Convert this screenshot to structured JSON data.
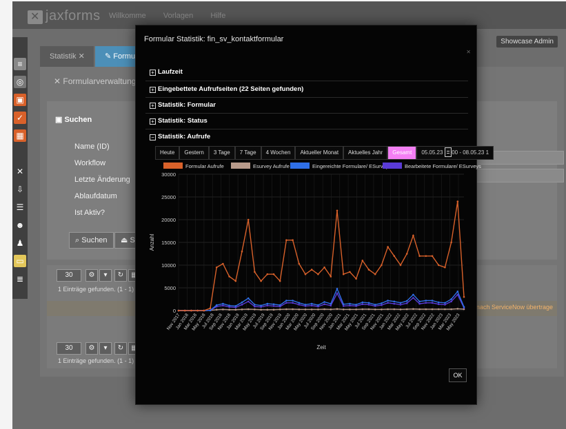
{
  "app": {
    "logo": "jaxforms",
    "nav": [
      "Willkomme",
      "Vorlagen",
      "Hilfe"
    ],
    "user": "Showcase Admin"
  },
  "tabs": [
    {
      "label": "Statistik"
    },
    {
      "label": "Formular"
    }
  ],
  "page": {
    "title": "Formularverwaltung"
  },
  "search": {
    "header": "Suchen",
    "fields": [
      "Name (ID)",
      "Workflow",
      "Letzte Änderung",
      "Ablaufdatum",
      "Ist Aktiv?"
    ],
    "search_button": "Suchen",
    "filter_button": "Suchfilt"
  },
  "grid": {
    "page_size": "30",
    "found_text": "1 Einträge gefunden. (1 - 1)",
    "row_note": "zten werden nach ServiceNow übertrage"
  },
  "modal": {
    "title": "Formular Statistik: fin_sv_kontaktformular",
    "sections": [
      {
        "label": "Laufzeit",
        "open": false
      },
      {
        "label": "Eingebettete Aufrufseiten (22 Seiten gefunden)",
        "open": false
      },
      {
        "label": "Statistik: Formular",
        "open": false
      },
      {
        "label": "Statistik: Status",
        "open": false
      },
      {
        "label": "Statistik: Aufrufe",
        "open": true
      }
    ],
    "ranges": [
      "Heute",
      "Gestern",
      "3 Tage",
      "7 Tage",
      "4 Wochen",
      "Aktueller Monat",
      "Aktuelles Jahr",
      "Gesamt"
    ],
    "active_range": "Gesamt",
    "date_range": "05.05.23 11:00 - 08.05.23 1",
    "ok_label": "OK"
  },
  "chart_data": {
    "type": "line",
    "title": "",
    "xlabel": "Zeit",
    "ylabel": "Anzahl",
    "ylim": [
      0,
      30000
    ],
    "yticks": [
      0,
      5000,
      10000,
      15000,
      20000,
      25000,
      30000
    ],
    "grid": true,
    "legend_position": "top",
    "categories": [
      "Nov 2017",
      "Jan 2018",
      "Mar 2018",
      "May 2018",
      "Jul 2018",
      "Sep 2018",
      "Nov 2018",
      "Jan 2019",
      "Mar 2019",
      "May 2019",
      "Jul 2019",
      "Sep 2019",
      "Nov 2019",
      "Jan 2020",
      "Mar 2020",
      "May 2020",
      "Jul 2020",
      "Sep 2020",
      "Nov 2020",
      "Jan 2021",
      "Mar 2021",
      "May 2021",
      "Jul 2021",
      "Sep 2021",
      "Nov 2021",
      "Jan 2022",
      "Mar 2022",
      "May 2022",
      "Jul 2022",
      "Sep 2022",
      "Nov 2022",
      "Jan 2023",
      "Mar 2023",
      "May 2023"
    ],
    "series": [
      {
        "name": "Formular Aufrufe",
        "color": "#d9612a",
        "values": [
          0,
          0,
          0,
          0,
          0,
          500,
          9500,
          10300,
          7500,
          6500,
          13000,
          20000,
          8500,
          6500,
          8000,
          8000,
          6500,
          15500,
          15500,
          10300,
          8000,
          9000,
          8000,
          9500,
          7500,
          22000,
          8000,
          8500,
          7000,
          11000,
          9000,
          8000,
          10000,
          14000,
          12000,
          10000,
          12500,
          16500,
          12000,
          12000,
          12000,
          10000,
          9500,
          15000,
          24000,
          3000
        ]
      },
      {
        "name": "Esurvey Aufrufe",
        "color": "#b89a8a",
        "values": [
          0,
          0,
          0,
          0,
          0,
          50,
          200,
          250,
          200,
          200,
          250,
          300,
          250,
          200,
          200,
          200,
          250,
          300,
          300,
          250,
          250,
          250,
          250,
          300,
          250,
          350,
          250,
          250,
          250,
          300,
          300,
          250,
          250,
          300,
          300,
          250,
          300,
          350,
          300,
          300,
          300,
          300,
          300,
          300,
          400,
          300
        ]
      },
      {
        "name": "Eingereichte Formulare/ ESurveys",
        "color": "#2f6fe8",
        "values": [
          0,
          0,
          0,
          0,
          0,
          50,
          1200,
          1500,
          1100,
          1000,
          1800,
          2700,
          1300,
          1100,
          1500,
          1400,
          1200,
          2200,
          2200,
          1700,
          1300,
          1500,
          1200,
          1900,
          1500,
          4800,
          1400,
          1500,
          1300,
          1800,
          1700,
          1300,
          1600,
          2200,
          2000,
          1700,
          2100,
          3500,
          2000,
          2200,
          2200,
          1800,
          1700,
          2500,
          4200,
          800
        ]
      },
      {
        "name": "Bearbeitete Formulare/ ESurveys",
        "color": "#5a3bd6",
        "values": [
          0,
          0,
          0,
          0,
          0,
          30,
          900,
          1100,
          800,
          700,
          1300,
          2000,
          900,
          800,
          1100,
          1000,
          900,
          1700,
          1700,
          1300,
          1000,
          1100,
          900,
          1400,
          1100,
          3800,
          1000,
          1100,
          1000,
          1400,
          1300,
          1000,
          1200,
          1700,
          1500,
          1300,
          1600,
          2800,
          1500,
          1700,
          1700,
          1400,
          1300,
          2000,
          3500,
          600
        ]
      }
    ]
  }
}
